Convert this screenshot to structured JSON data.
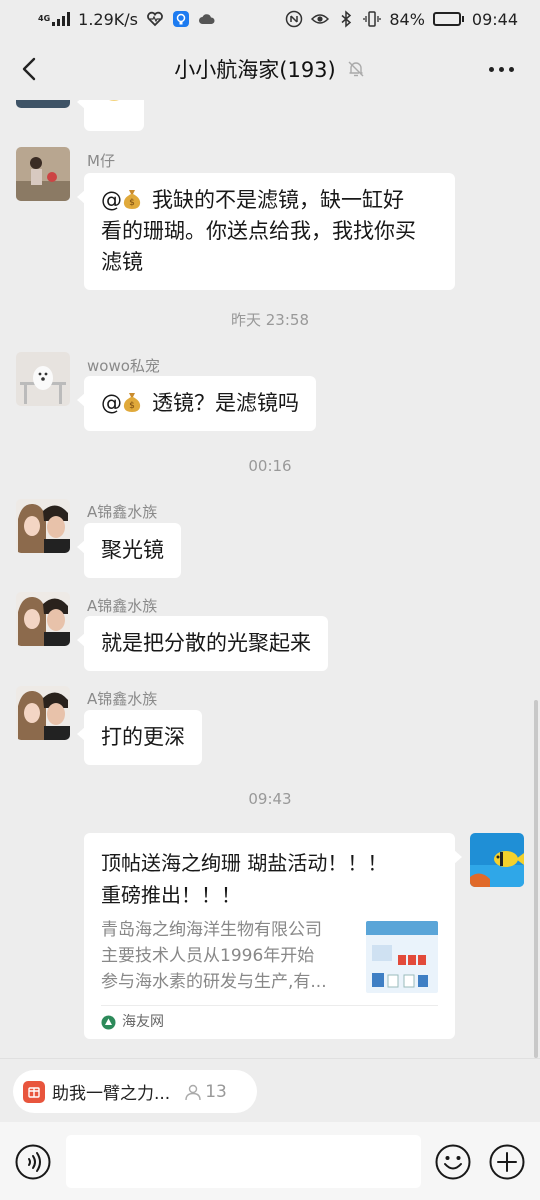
{
  "status_bar": {
    "network_tag": "4G",
    "speed": "1.29K/s",
    "battery": "84%",
    "battery_level": 0.84,
    "time": "09:44"
  },
  "header": {
    "title": "小小航海家(193)",
    "icons": [
      "back-arrow-icon",
      "mute-bell-icon",
      "more-icon"
    ]
  },
  "messages": [
    {
      "sender": "M仔",
      "at": "@",
      "text": "我缺的不是滤镜，缺一缸好",
      "text2": "看的珊瑚。你送点给我，我找你买",
      "text3": "滤镜"
    },
    {
      "sender": "wowo私宠",
      "at": "@",
      "text": "透镜？是滤镜吗"
    },
    {
      "sender": "A锦鑫水族",
      "text": "聚光镜"
    },
    {
      "sender": "A锦鑫水族",
      "text": "就是把分散的光聚起来"
    },
    {
      "sender": "A锦鑫水族",
      "text": "打的更深"
    }
  ],
  "timestamps": [
    "昨天 23:58",
    "00:16",
    "09:43"
  ],
  "link_card": {
    "title_line1": "顶帖送海之绚珊 瑚盐活动！！！",
    "title_line2": "重磅推出！！！",
    "desc_line1": "青岛海之绚海洋生物有限公司",
    "desc_line2": "主要技术人员从1996年开始",
    "desc_line3": "参与海水素的研发与生产,有...",
    "source": "海友网"
  },
  "pinned": {
    "label": "助我一臂之力...",
    "count": "13"
  },
  "input": {
    "placeholder": ""
  },
  "colors": {
    "background": "#ededed",
    "bubble": "#ffffff",
    "pinned_icon": "#e8553d"
  }
}
